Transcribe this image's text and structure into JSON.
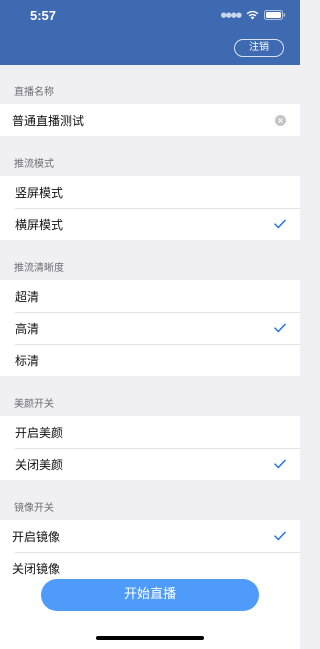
{
  "status_bar": {
    "time": "5:57"
  },
  "navbar": {
    "logout_label": "注销"
  },
  "sections": {
    "name": {
      "header": "直播名称",
      "value": "普通直播测试"
    },
    "stream_mode": {
      "header": "推流模式",
      "options": [
        "竖屏模式",
        "横屏模式"
      ],
      "selected": "横屏模式"
    },
    "resolution": {
      "header": "推流清晰度",
      "options": [
        "超清",
        "高清",
        "标清"
      ],
      "selected": "高清"
    },
    "beauty": {
      "header": "美颜开关",
      "options": [
        "开启美颜",
        "关闭美颜"
      ],
      "selected": "关闭美颜"
    },
    "mirror": {
      "header": "镜像开关",
      "options": [
        "开启镜像",
        "关闭镜像"
      ],
      "selected": "开启镜像"
    }
  },
  "start_button_label": "开始直播",
  "colors": {
    "navbar": "#3d6ab0",
    "accent": "#4f9bf9",
    "check": "#2f7de1"
  }
}
